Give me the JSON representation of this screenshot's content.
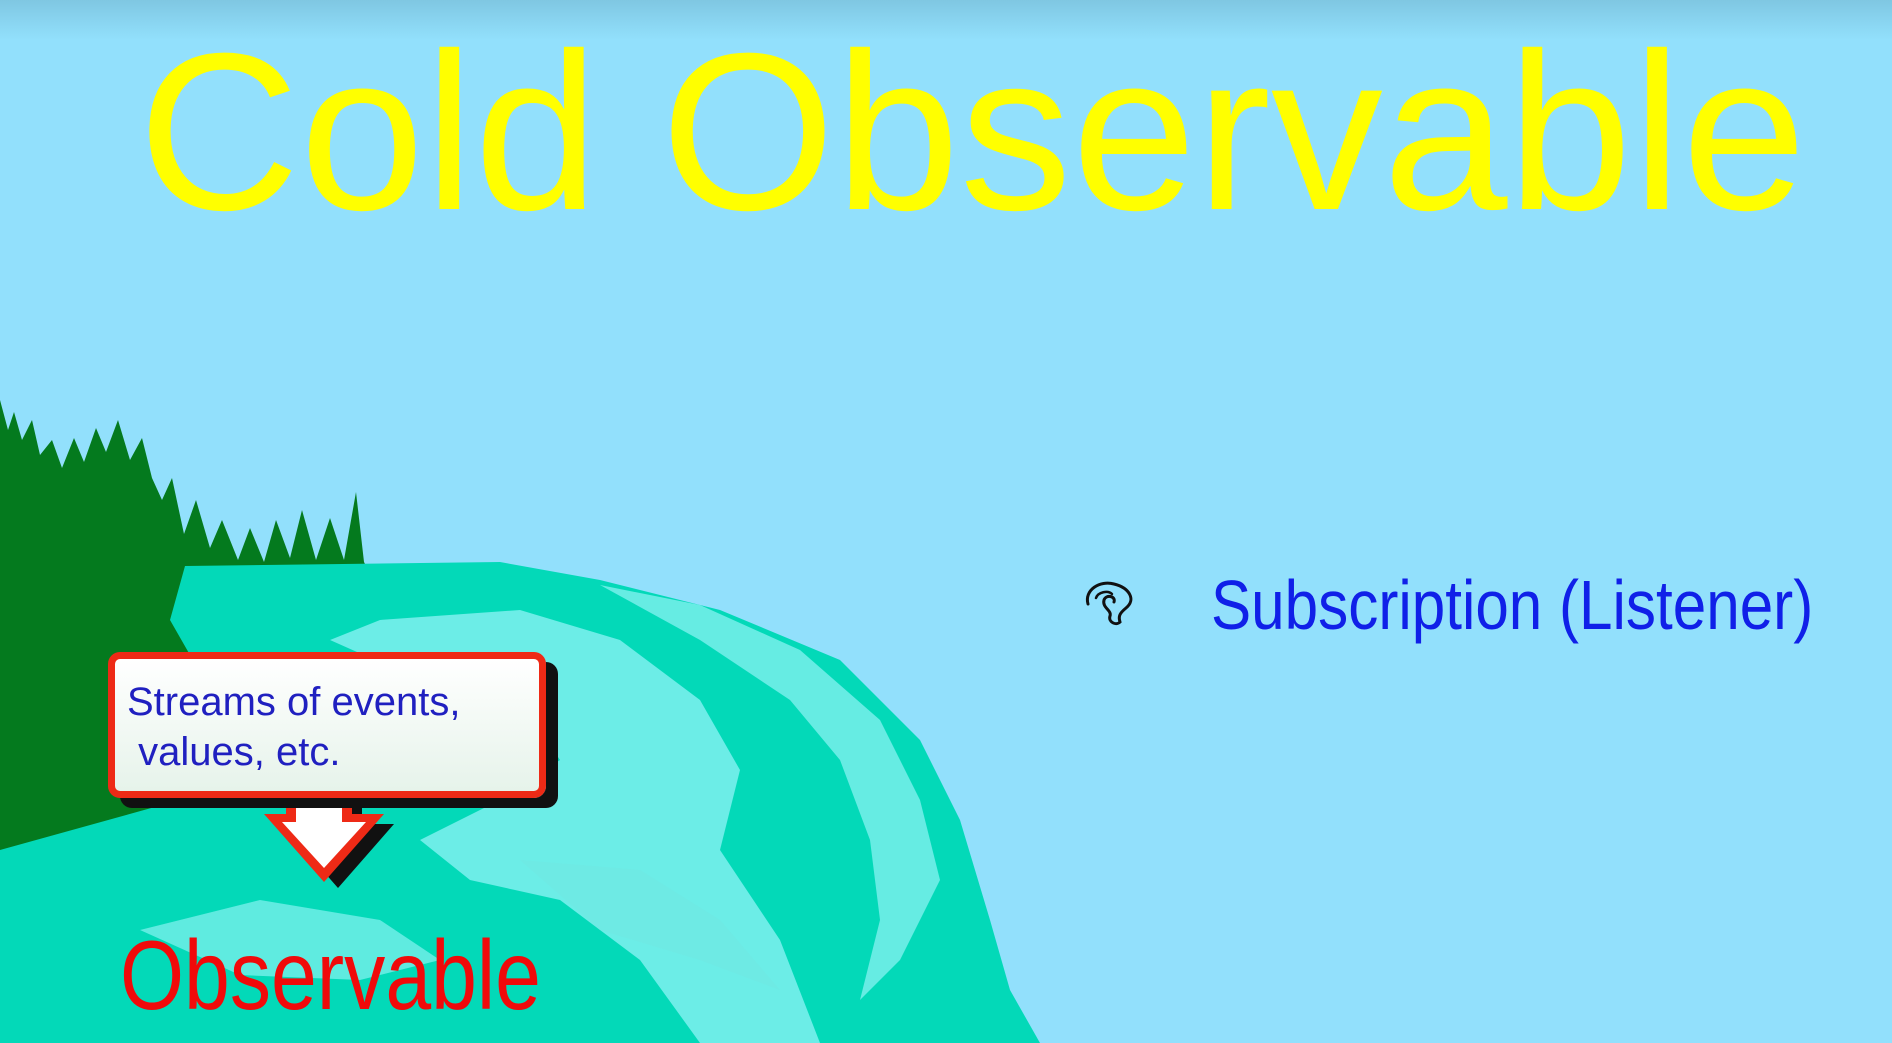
{
  "slide": {
    "title": "Cold Observable",
    "subscription_label": "Subscription (Listener)",
    "callout_text": "Streams of events,\n values, etc.",
    "observable_label": "Observable"
  },
  "icons": {
    "listener": "ear-icon",
    "callout_arrow": "arrow-down-icon"
  },
  "colors": {
    "background": "#92e0fc",
    "title": "#ffff00",
    "subscription": "#1020e8",
    "observable": "#f00a0a",
    "callout_border": "#ee2a16",
    "forest": "#047a1e",
    "river": "#03d9b8",
    "river_highlight": "#7ff0ee"
  }
}
